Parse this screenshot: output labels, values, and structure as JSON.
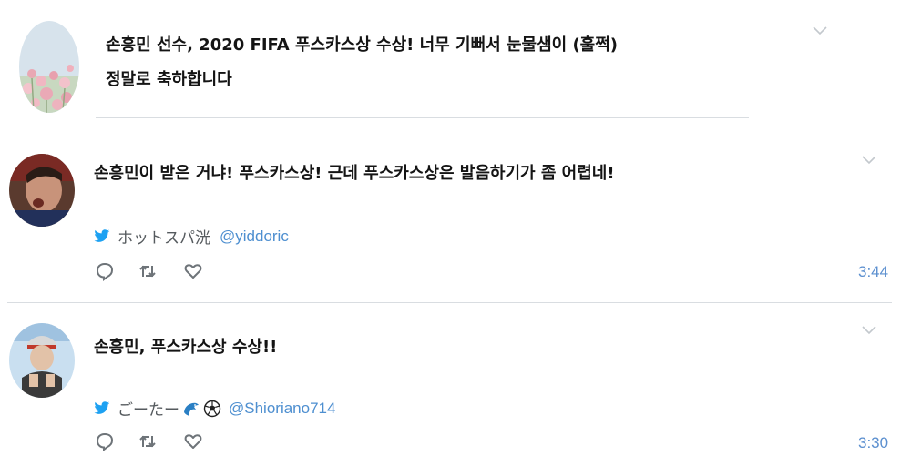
{
  "tweets": [
    {
      "text_line1": "손흥민 선수, 2020 FIFA 푸스카스상 수상! 너무 기뻐서 눈물샘이 (훌쩍)",
      "text_line2": "정말로 축하합니다",
      "avatar": "flower-avatar"
    },
    {
      "text": "손흥민이 받은 거냐! 푸스카스상! 근데 푸스카스상은 발음하기가 좀 어렵네!",
      "display_name": "ホットスパ洸",
      "handle": "@yiddoric",
      "time": "3:44",
      "avatar": "player-avatar"
    },
    {
      "text": "손흥민, 푸스카스상 수상!!",
      "display_name": "ごーたー",
      "handle": "@Shioriano714",
      "time": "3:30",
      "avatar": "person-avatar"
    }
  ],
  "icons": {
    "reply": "reply-icon",
    "retweet": "retweet-icon",
    "like": "heart-icon",
    "more": "chevron-down-icon",
    "source": "twitter-bird-icon"
  },
  "colors": {
    "accent_blue": "#1da1f2",
    "time_blue": "#5b8fcf",
    "handle_blue": "#4e8fd0",
    "divider": "#d9dde1"
  }
}
